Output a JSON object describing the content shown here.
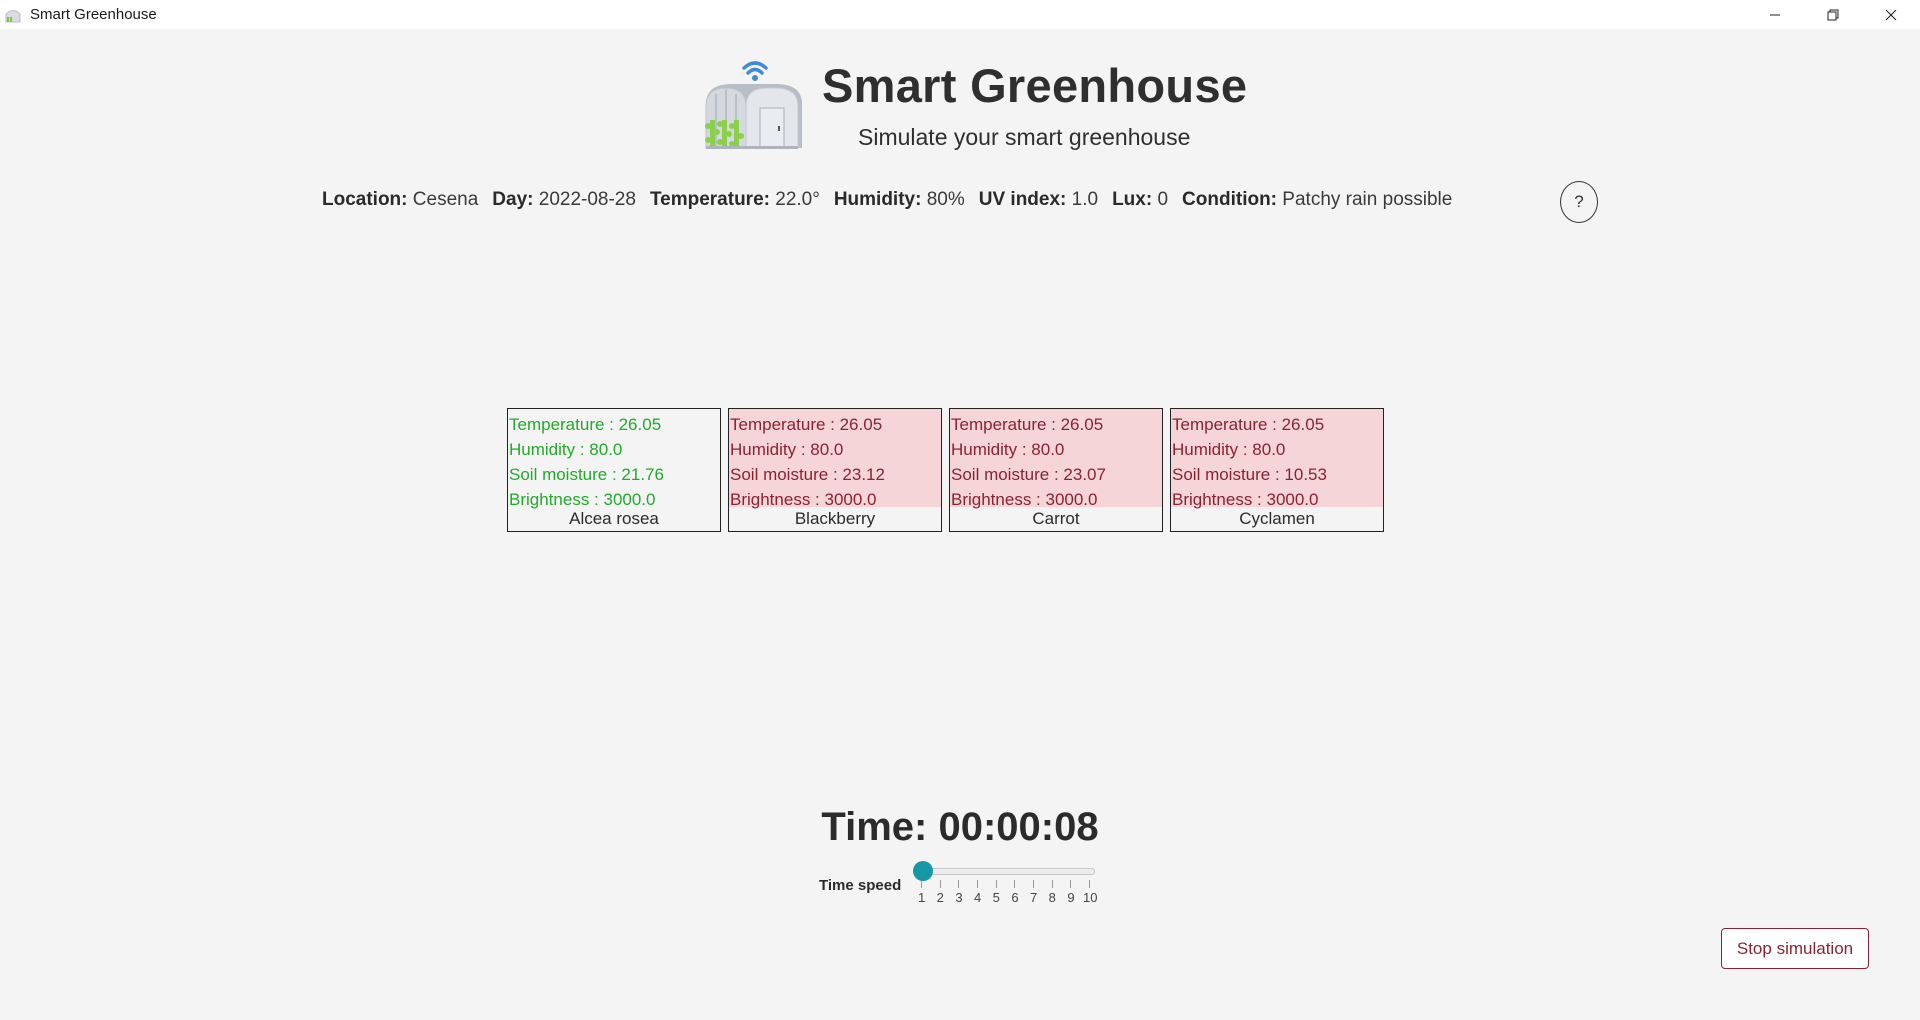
{
  "window": {
    "title": "Smart Greenhouse",
    "minimize_icon": "minimize-icon",
    "restore_icon": "restore-icon",
    "close_icon": "close-icon"
  },
  "header": {
    "title": "Smart Greenhouse",
    "subtitle": "Simulate your smart greenhouse"
  },
  "info": {
    "location_label": "Location:",
    "location": "Cesena",
    "day_label": "Day:",
    "day": "2022-08-28",
    "temperature_label": "Temperature:",
    "temperature": "22.0°",
    "humidity_label": "Humidity:",
    "humidity": "80%",
    "uv_label": "UV index:",
    "uv": "1.0",
    "lux_label": "Lux:",
    "lux": "0",
    "condition_label": "Condition:",
    "condition": "Patchy rain possible",
    "help_label": "?"
  },
  "plants": [
    {
      "status": "ok",
      "temperature": "Temperature : 26.05",
      "humidity": "Humidity : 80.0",
      "soil": "Soil moisture : 21.76",
      "brightness": "Brightness : 3000.0",
      "name": "Alcea rosea"
    },
    {
      "status": "bad",
      "temperature": "Temperature : 26.05",
      "humidity": "Humidity : 80.0",
      "soil": "Soil moisture : 23.12",
      "brightness": "Brightness : 3000.0",
      "name": "Blackberry"
    },
    {
      "status": "bad",
      "temperature": "Temperature : 26.05",
      "humidity": "Humidity : 80.0",
      "soil": "Soil moisture : 23.07",
      "brightness": "Brightness : 3000.0",
      "name": "Carrot"
    },
    {
      "status": "bad",
      "temperature": "Temperature : 26.05",
      "humidity": "Humidity : 80.0",
      "soil": "Soil moisture : 10.53",
      "brightness": "Brightness : 3000.0",
      "name": "Cyclamen"
    }
  ],
  "colors": {
    "ok_text": "#22aa2a",
    "bad_text": "#8b2233",
    "bad_background": "#f5d5d8",
    "slider_accent": "#1597a6"
  },
  "time": {
    "label": "Time: 00:00:08",
    "speed_label": "Time speed",
    "speed_value": 1,
    "speed_ticks": [
      "1",
      "2",
      "3",
      "4",
      "5",
      "6",
      "7",
      "8",
      "9",
      "10"
    ]
  },
  "actions": {
    "stop_label": "Stop simulation"
  }
}
